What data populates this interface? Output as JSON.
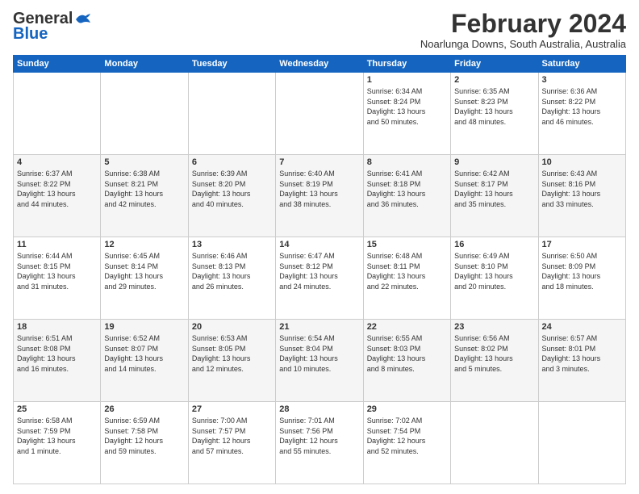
{
  "header": {
    "logo_general": "General",
    "logo_blue": "Blue",
    "month_title": "February 2024",
    "subtitle": "Noarlunga Downs, South Australia, Australia"
  },
  "weekdays": [
    "Sunday",
    "Monday",
    "Tuesday",
    "Wednesday",
    "Thursday",
    "Friday",
    "Saturday"
  ],
  "weeks": [
    [
      {
        "day": "",
        "info": ""
      },
      {
        "day": "",
        "info": ""
      },
      {
        "day": "",
        "info": ""
      },
      {
        "day": "",
        "info": ""
      },
      {
        "day": "1",
        "info": "Sunrise: 6:34 AM\nSunset: 8:24 PM\nDaylight: 13 hours\nand 50 minutes."
      },
      {
        "day": "2",
        "info": "Sunrise: 6:35 AM\nSunset: 8:23 PM\nDaylight: 13 hours\nand 48 minutes."
      },
      {
        "day": "3",
        "info": "Sunrise: 6:36 AM\nSunset: 8:22 PM\nDaylight: 13 hours\nand 46 minutes."
      }
    ],
    [
      {
        "day": "4",
        "info": "Sunrise: 6:37 AM\nSunset: 8:22 PM\nDaylight: 13 hours\nand 44 minutes."
      },
      {
        "day": "5",
        "info": "Sunrise: 6:38 AM\nSunset: 8:21 PM\nDaylight: 13 hours\nand 42 minutes."
      },
      {
        "day": "6",
        "info": "Sunrise: 6:39 AM\nSunset: 8:20 PM\nDaylight: 13 hours\nand 40 minutes."
      },
      {
        "day": "7",
        "info": "Sunrise: 6:40 AM\nSunset: 8:19 PM\nDaylight: 13 hours\nand 38 minutes."
      },
      {
        "day": "8",
        "info": "Sunrise: 6:41 AM\nSunset: 8:18 PM\nDaylight: 13 hours\nand 36 minutes."
      },
      {
        "day": "9",
        "info": "Sunrise: 6:42 AM\nSunset: 8:17 PM\nDaylight: 13 hours\nand 35 minutes."
      },
      {
        "day": "10",
        "info": "Sunrise: 6:43 AM\nSunset: 8:16 PM\nDaylight: 13 hours\nand 33 minutes."
      }
    ],
    [
      {
        "day": "11",
        "info": "Sunrise: 6:44 AM\nSunset: 8:15 PM\nDaylight: 13 hours\nand 31 minutes."
      },
      {
        "day": "12",
        "info": "Sunrise: 6:45 AM\nSunset: 8:14 PM\nDaylight: 13 hours\nand 29 minutes."
      },
      {
        "day": "13",
        "info": "Sunrise: 6:46 AM\nSunset: 8:13 PM\nDaylight: 13 hours\nand 26 minutes."
      },
      {
        "day": "14",
        "info": "Sunrise: 6:47 AM\nSunset: 8:12 PM\nDaylight: 13 hours\nand 24 minutes."
      },
      {
        "day": "15",
        "info": "Sunrise: 6:48 AM\nSunset: 8:11 PM\nDaylight: 13 hours\nand 22 minutes."
      },
      {
        "day": "16",
        "info": "Sunrise: 6:49 AM\nSunset: 8:10 PM\nDaylight: 13 hours\nand 20 minutes."
      },
      {
        "day": "17",
        "info": "Sunrise: 6:50 AM\nSunset: 8:09 PM\nDaylight: 13 hours\nand 18 minutes."
      }
    ],
    [
      {
        "day": "18",
        "info": "Sunrise: 6:51 AM\nSunset: 8:08 PM\nDaylight: 13 hours\nand 16 minutes."
      },
      {
        "day": "19",
        "info": "Sunrise: 6:52 AM\nSunset: 8:07 PM\nDaylight: 13 hours\nand 14 minutes."
      },
      {
        "day": "20",
        "info": "Sunrise: 6:53 AM\nSunset: 8:05 PM\nDaylight: 13 hours\nand 12 minutes."
      },
      {
        "day": "21",
        "info": "Sunrise: 6:54 AM\nSunset: 8:04 PM\nDaylight: 13 hours\nand 10 minutes."
      },
      {
        "day": "22",
        "info": "Sunrise: 6:55 AM\nSunset: 8:03 PM\nDaylight: 13 hours\nand 8 minutes."
      },
      {
        "day": "23",
        "info": "Sunrise: 6:56 AM\nSunset: 8:02 PM\nDaylight: 13 hours\nand 5 minutes."
      },
      {
        "day": "24",
        "info": "Sunrise: 6:57 AM\nSunset: 8:01 PM\nDaylight: 13 hours\nand 3 minutes."
      }
    ],
    [
      {
        "day": "25",
        "info": "Sunrise: 6:58 AM\nSunset: 7:59 PM\nDaylight: 13 hours\nand 1 minute."
      },
      {
        "day": "26",
        "info": "Sunrise: 6:59 AM\nSunset: 7:58 PM\nDaylight: 12 hours\nand 59 minutes."
      },
      {
        "day": "27",
        "info": "Sunrise: 7:00 AM\nSunset: 7:57 PM\nDaylight: 12 hours\nand 57 minutes."
      },
      {
        "day": "28",
        "info": "Sunrise: 7:01 AM\nSunset: 7:56 PM\nDaylight: 12 hours\nand 55 minutes."
      },
      {
        "day": "29",
        "info": "Sunrise: 7:02 AM\nSunset: 7:54 PM\nDaylight: 12 hours\nand 52 minutes."
      },
      {
        "day": "",
        "info": ""
      },
      {
        "day": "",
        "info": ""
      }
    ]
  ]
}
